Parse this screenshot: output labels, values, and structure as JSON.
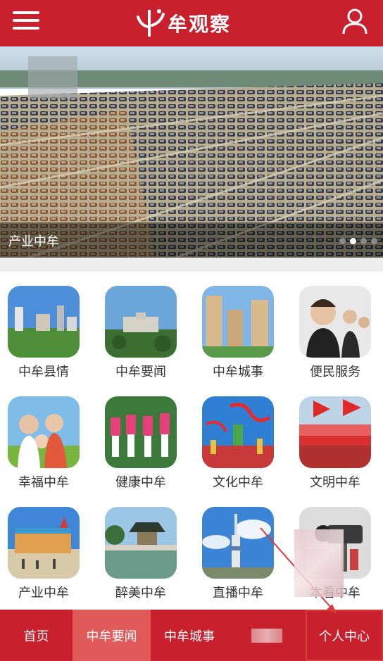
{
  "header": {
    "brand_text": "牟观察",
    "menu_icon": "hamburger-menu-icon",
    "user_icon": "user-profile-icon"
  },
  "banner": {
    "caption": "产业中牟",
    "slide_count": 4,
    "active_slide": 1
  },
  "categories": [
    {
      "label": "中牟县情",
      "icon": "county-skyline-photo"
    },
    {
      "label": "中牟要闻",
      "icon": "government-building-photo"
    },
    {
      "label": "中牟城事",
      "icon": "residential-towers-photo"
    },
    {
      "label": "便民服务",
      "icon": "call-center-photo"
    },
    {
      "label": "幸福中牟",
      "icon": "happy-family-photo"
    },
    {
      "label": "健康中牟",
      "icon": "dancing-group-photo"
    },
    {
      "label": "文化中牟",
      "icon": "ribbon-dance-photo"
    },
    {
      "label": "文明中牟",
      "icon": "rally-banner-photo"
    },
    {
      "label": "产业中牟",
      "icon": "theme-park-photo"
    },
    {
      "label": "醉美中牟",
      "icon": "pavilion-lake-photo"
    },
    {
      "label": "直播中牟",
      "icon": "tv-tower-photo"
    },
    {
      "label": "本看中牟",
      "icon": "video-camera-photo"
    }
  ],
  "bottom_nav": [
    {
      "label": "首页"
    },
    {
      "label": "中牟要闻"
    },
    {
      "label": "中牟城事"
    },
    {
      "label": ""
    },
    {
      "label": "个人中心"
    }
  ],
  "colors": {
    "brand_red": "#c8202d",
    "active_tab": "#e05a5a",
    "annotation_red": "#d93a3a"
  }
}
